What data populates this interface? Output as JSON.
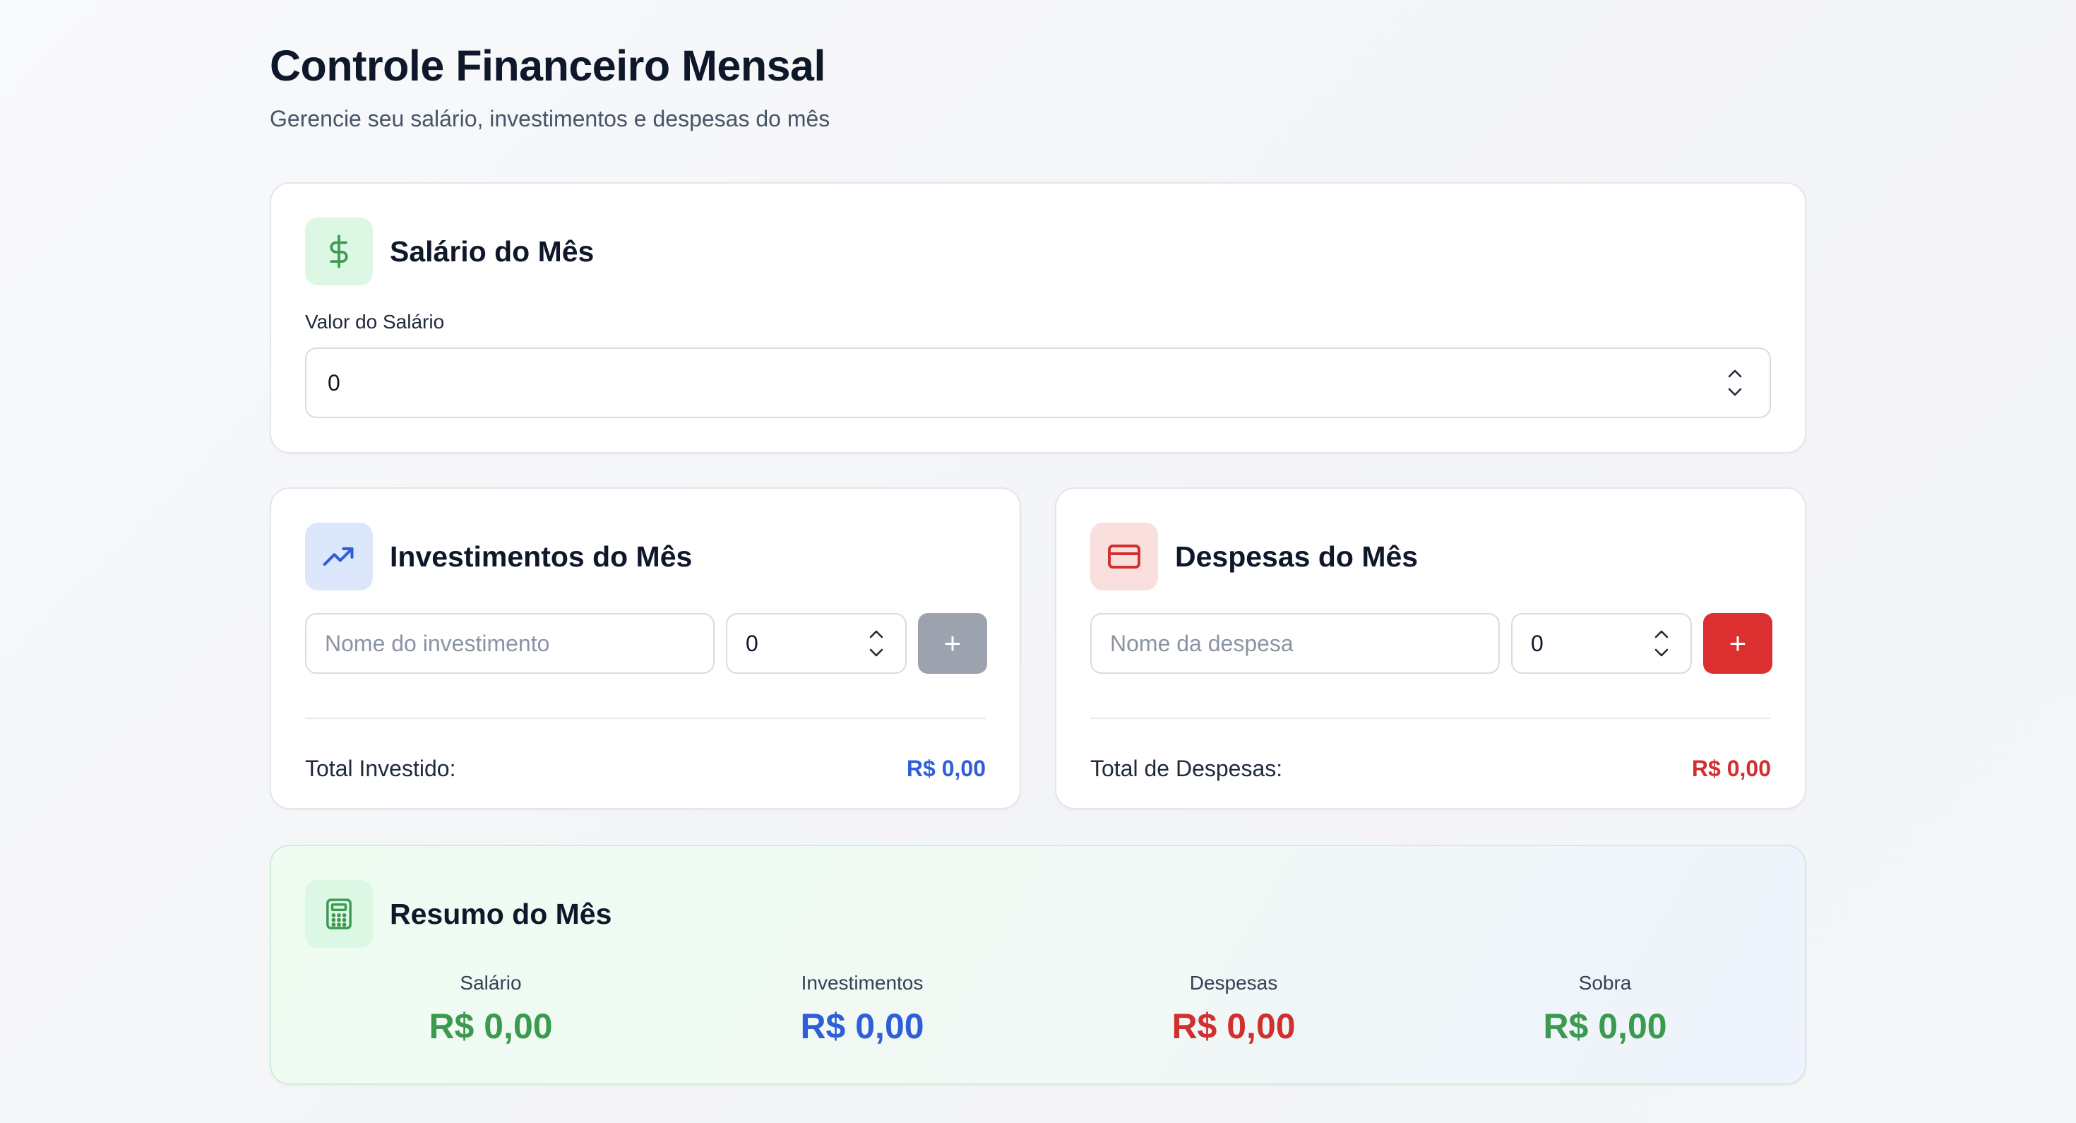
{
  "header": {
    "title": "Controle Financeiro Mensal",
    "subtitle": "Gerencie seu salário, investimentos e despesas do mês"
  },
  "salary": {
    "title": "Salário do Mês",
    "icon": "dollar-sign-icon",
    "field_label": "Valor do Salário",
    "value": "0"
  },
  "investments": {
    "title": "Investimentos do Mês",
    "icon": "trending-up-icon",
    "name_placeholder": "Nome do investimento",
    "amount_value": "0",
    "add_label": "+",
    "total_label": "Total Investido:",
    "total_value": "R$ 0,00"
  },
  "expenses": {
    "title": "Despesas do Mês",
    "icon": "credit-card-icon",
    "name_placeholder": "Nome da despesa",
    "amount_value": "0",
    "add_label": "+",
    "total_label": "Total de Despesas:",
    "total_value": "R$ 0,00"
  },
  "summary": {
    "title": "Resumo do Mês",
    "icon": "calculator-icon",
    "items": [
      {
        "label": "Salário",
        "value": "R$ 0,00",
        "color": "#3c9a4f"
      },
      {
        "label": "Investimentos",
        "value": "R$ 0,00",
        "color": "#2e5fd8"
      },
      {
        "label": "Despesas",
        "value": "R$ 0,00",
        "color": "#d22f2f"
      },
      {
        "label": "Sobra",
        "value": "R$ 0,00",
        "color": "#3c9a4f"
      }
    ]
  },
  "colors": {
    "green": "#3c9a4f",
    "blue": "#2e5fd8",
    "red": "#d22f2f",
    "add_button_disabled": "#9ca3af",
    "add_button_active": "#dc2f2f"
  }
}
